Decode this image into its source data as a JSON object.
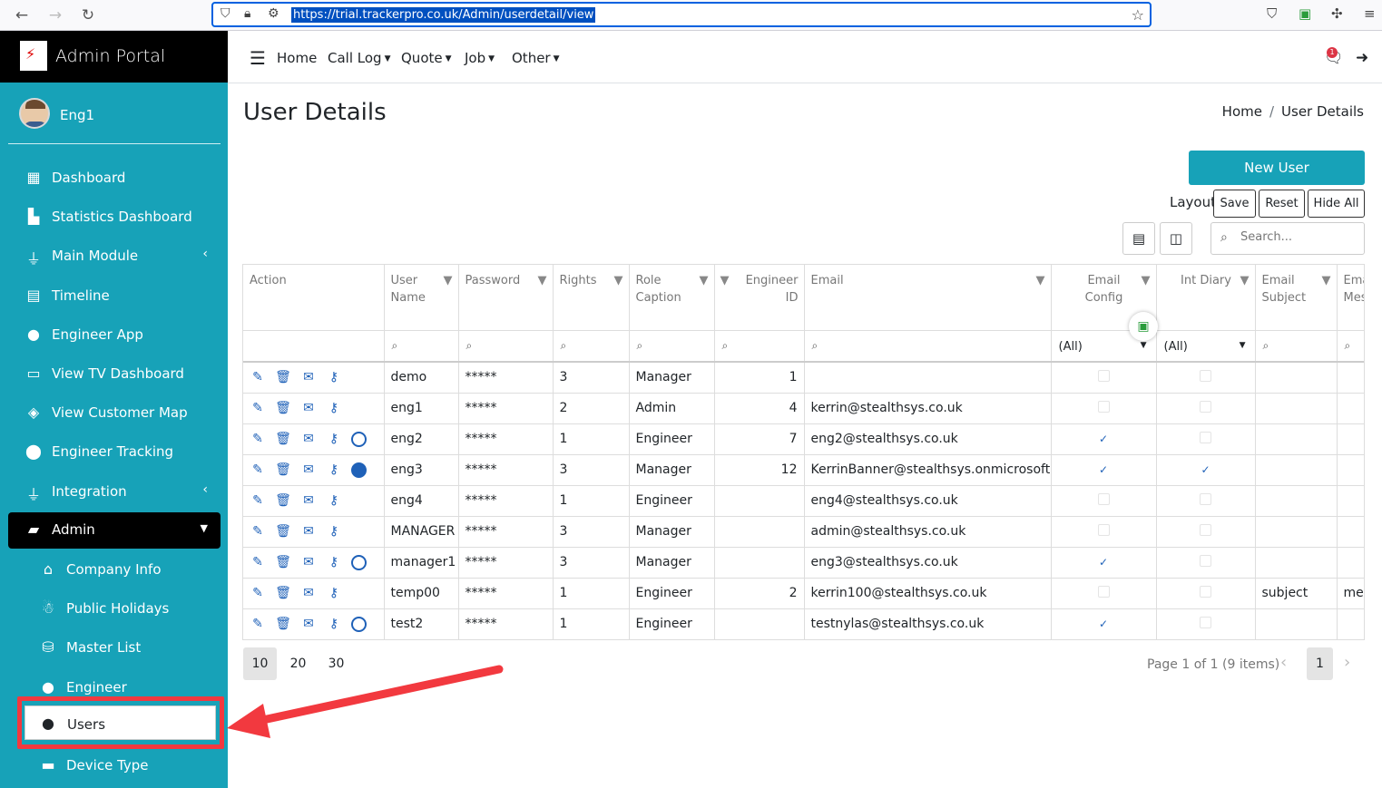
{
  "browser": {
    "url": "https://trial.trackerpro.co.uk/Admin/userdetail/view"
  },
  "brand": {
    "title": "Admin Portal"
  },
  "user": {
    "name": "Eng1"
  },
  "sidebar": {
    "items": [
      {
        "label": "Dashboard",
        "icon": "grid-icon"
      },
      {
        "label": "Statistics Dashboard",
        "icon": "bar-chart-icon"
      },
      {
        "label": "Main Module",
        "icon": "plug-icon"
      },
      {
        "label": "Timeline",
        "icon": "calendar-icon"
      },
      {
        "label": "Engineer App",
        "icon": "user-cog-icon"
      },
      {
        "label": "View TV Dashboard",
        "icon": "monitor-icon"
      },
      {
        "label": "View Customer Map",
        "icon": "map-icon"
      },
      {
        "label": "Engineer Tracking",
        "icon": "map-pin-icon"
      },
      {
        "label": "Integration",
        "icon": "plug-icon"
      },
      {
        "label": "Admin",
        "icon": "toolbox-icon"
      }
    ],
    "subitems": [
      {
        "label": "Company Info",
        "icon": "home-icon"
      },
      {
        "label": "Public Holidays",
        "icon": "snowman-icon"
      },
      {
        "label": "Master List",
        "icon": "database-icon"
      },
      {
        "label": "Engineer",
        "icon": "user-cog-icon"
      },
      {
        "label": "Users",
        "icon": "user-icon"
      },
      {
        "label": "Device Type",
        "icon": "briefcase-icon"
      }
    ]
  },
  "topnav": {
    "links": [
      "Home",
      "Call Log",
      "Quote",
      "Job",
      "Other"
    ],
    "notification_count": "1"
  },
  "page": {
    "title": "User Details",
    "breadcrumb": [
      "Home",
      "User Details"
    ],
    "new_user_label": "New User",
    "layout_label": "Layout",
    "save_label": "Save",
    "reset_label": "Reset",
    "hide_all_label": "Hide All",
    "search_placeholder": "Search..."
  },
  "table": {
    "headers": [
      "Action",
      "User Name",
      "Password",
      "Rights",
      "Role Caption",
      "Engineer ID",
      "Email",
      "Email Config",
      "Int Diary",
      "Email Subject",
      "Email Message"
    ],
    "filter_all": "(All)",
    "rows": [
      {
        "user": "demo",
        "password": "*****",
        "rights": "3",
        "role": "Manager",
        "eng_id": "1",
        "email": "",
        "email_config": false,
        "int_diary": false,
        "subject": "",
        "message": "",
        "circle": "none"
      },
      {
        "user": "eng1",
        "password": "*****",
        "rights": "2",
        "role": "Admin",
        "eng_id": "4",
        "email": "kerrin@stealthsys.co.uk",
        "email_config": false,
        "int_diary": false,
        "subject": "",
        "message": "",
        "circle": "none"
      },
      {
        "user": "eng2",
        "password": "*****",
        "rights": "1",
        "role": "Engineer",
        "eng_id": "7",
        "email": "eng2@stealthsys.co.uk",
        "email_config": true,
        "int_diary": false,
        "subject": "",
        "message": "",
        "circle": "empty"
      },
      {
        "user": "eng3",
        "password": "*****",
        "rights": "3",
        "role": "Manager",
        "eng_id": "12",
        "email": "KerrinBanner@stealthsys.onmicrosoft.com",
        "email_config": true,
        "int_diary": true,
        "subject": "",
        "message": "",
        "circle": "filled"
      },
      {
        "user": "eng4",
        "password": "*****",
        "rights": "1",
        "role": "Engineer",
        "eng_id": "",
        "email": "eng4@stealthsys.co.uk",
        "email_config": false,
        "int_diary": false,
        "subject": "",
        "message": "",
        "circle": "none"
      },
      {
        "user": "MANAGER",
        "password": "*****",
        "rights": "3",
        "role": "Manager",
        "eng_id": "",
        "email": "admin@stealthsys.co.uk",
        "email_config": false,
        "int_diary": false,
        "subject": "",
        "message": "",
        "circle": "none"
      },
      {
        "user": "manager1",
        "password": "*****",
        "rights": "3",
        "role": "Manager",
        "eng_id": "",
        "email": "eng3@stealthsys.co.uk",
        "email_config": true,
        "int_diary": false,
        "subject": "",
        "message": "",
        "circle": "empty"
      },
      {
        "user": "temp00",
        "password": "*****",
        "rights": "1",
        "role": "Engineer",
        "eng_id": "2",
        "email": "kerrin100@stealthsys.co.uk",
        "email_config": false,
        "int_diary": false,
        "subject": "subject",
        "message": "mes",
        "circle": "none"
      },
      {
        "user": "test2",
        "password": "*****",
        "rights": "1",
        "role": "Engineer",
        "eng_id": "",
        "email": "testnylas@stealthsys.co.uk",
        "email_config": true,
        "int_diary": false,
        "subject": "",
        "message": "",
        "circle": "empty"
      }
    ]
  },
  "pager": {
    "sizes": [
      "10",
      "20",
      "30"
    ],
    "info": "Page 1 of 1 (9 items)",
    "current": "1"
  },
  "colors": {
    "accent": "#17a2b8",
    "action_icon": "#1f61b8",
    "annotation": "#f2393f"
  }
}
